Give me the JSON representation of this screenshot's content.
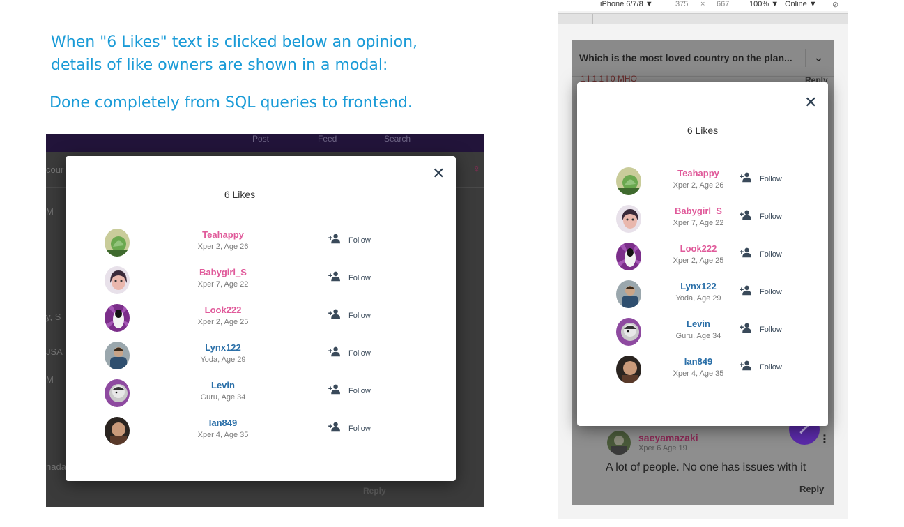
{
  "captions": {
    "line1": "When \"6 Likes\" text is clicked below an opinion,",
    "line2": "details of like owners are shown in a modal:",
    "line3": "Done completely from SQL queries to frontend."
  },
  "desktop": {
    "nav": [
      "Post",
      "Feed",
      "Search"
    ],
    "bg_fragments": [
      "cour",
      "M",
      "y, S",
      "JSA",
      "M",
      "nada"
    ],
    "reply_label": "Reply"
  },
  "devtools": {
    "device": "iPhone 6/7/8 ▼",
    "width": "375",
    "times": "×",
    "height": "667",
    "zoom": "100% ▼",
    "network": "Online ▼"
  },
  "mobile_bg": {
    "question_title": "Which is the most loved country on the plan...",
    "votes": "1 | 1     1 | 0     MHO",
    "reply_label": "Reply",
    "comment": {
      "author": "saeyamazaki",
      "stats": "Xper 6   Age 19",
      "text": "A lot of people. No one has issues with it",
      "reply_label": "Reply"
    }
  },
  "modal": {
    "title": "6 Likes",
    "close_label": "✕",
    "follow_label": "Follow",
    "users": [
      {
        "name": "Teahappy",
        "stats": "Xper 2, Age 26",
        "color": "#e05a9a"
      },
      {
        "name": "Babygirl_S",
        "stats": "Xper 7, Age 22",
        "color": "#e05a9a"
      },
      {
        "name": "Look222",
        "stats": "Xper 2, Age 25",
        "color": "#e05a9a"
      },
      {
        "name": "Lynx122",
        "stats": "Yoda, Age 29",
        "color": "#2a6fa8"
      },
      {
        "name": "Levin",
        "stats": "Guru, Age 34",
        "color": "#2a6fa8"
      },
      {
        "name": "Ian849",
        "stats": "Xper 4, Age 35",
        "color": "#2a6fa8"
      }
    ]
  },
  "colors": {
    "caption": "#1a9bd7",
    "female_name": "#e05a9a",
    "male_name": "#2a6fa8"
  }
}
